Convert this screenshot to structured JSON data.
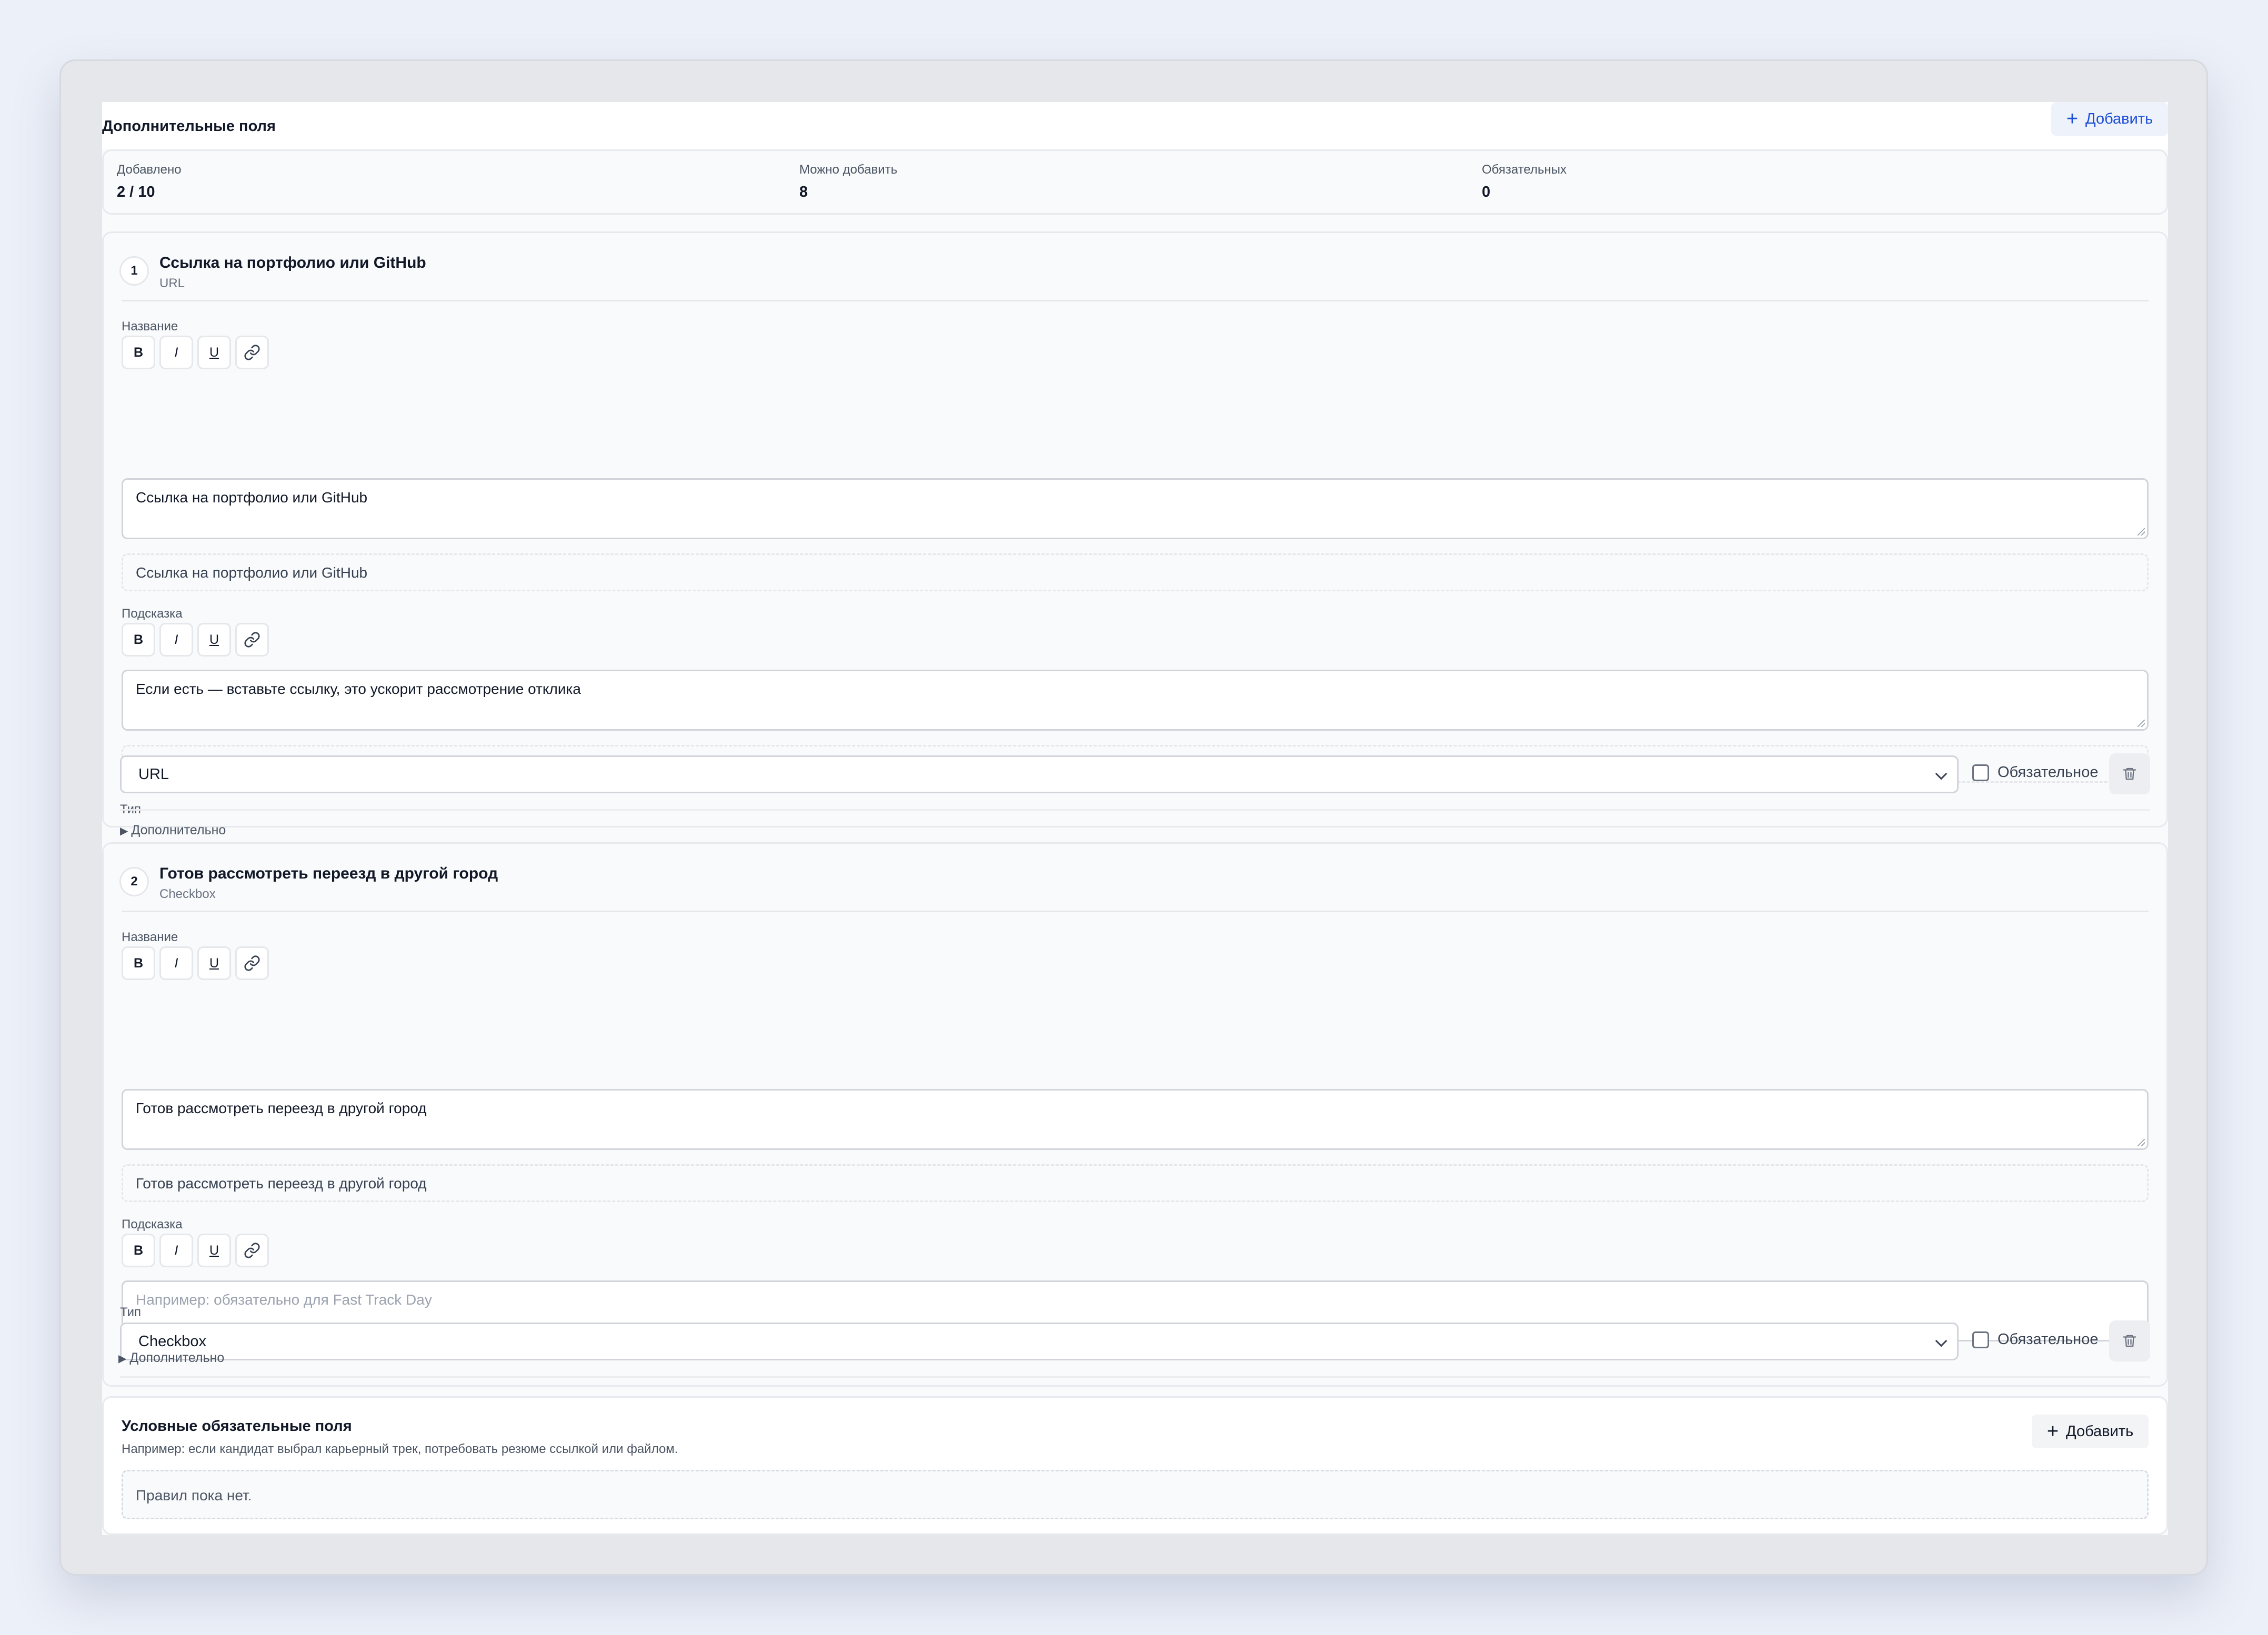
{
  "section": {
    "title": "Дополнительные поля",
    "add_label": "Добавить"
  },
  "stats": [
    {
      "label": "Добавлено",
      "value": "2 / 10"
    },
    {
      "label": "Можно добавить",
      "value": "8"
    },
    {
      "label": "Обязательных",
      "value": "0"
    }
  ],
  "toolbar": {
    "bold": "B",
    "italic": "I",
    "underline": "U"
  },
  "fields": [
    {
      "index": "1",
      "title": "Ссылка на портфолио или GitHub",
      "type_sub": "URL",
      "name_label": "Название",
      "name_value": "Ссылка на портфолио или GitHub",
      "name_preview": "Ссылка на портфолио или GitHub",
      "hint_label": "Подсказка",
      "hint_value": "Если есть — вставьте ссылку, это ускорит рассмотрение отклика",
      "hint_preview": "Если есть — вставьте ссылку, это ускорит рассмотрение отклика",
      "type_label": "Тип",
      "type_value": "URL",
      "required_label": "Обязательное",
      "more_label": "Дополнительно"
    },
    {
      "index": "2",
      "title": "Готов рассмотреть переезд в другой город",
      "type_sub": "Checkbox",
      "name_label": "Название",
      "name_value": "Готов рассмотреть переезд в другой город",
      "name_preview": "Готов рассмотреть переезд в другой город",
      "hint_label": "Подсказка",
      "hint_placeholder": "Например: обязательно для Fast Track Day",
      "type_label": "Тип",
      "type_value": "Checkbox",
      "required_label": "Обязательное",
      "more_label": "Дополнительно"
    }
  ],
  "conditional": {
    "title": "Условные обязательные поля",
    "subtitle": "Например: если кандидат выбрал карьерный трек, потребовать резюме ссылкой или файлом.",
    "add_label": "Добавить",
    "empty_text": "Правил пока нет."
  },
  "colors": {
    "accent": "#1d4ed8",
    "background": "#ecf0f8"
  }
}
